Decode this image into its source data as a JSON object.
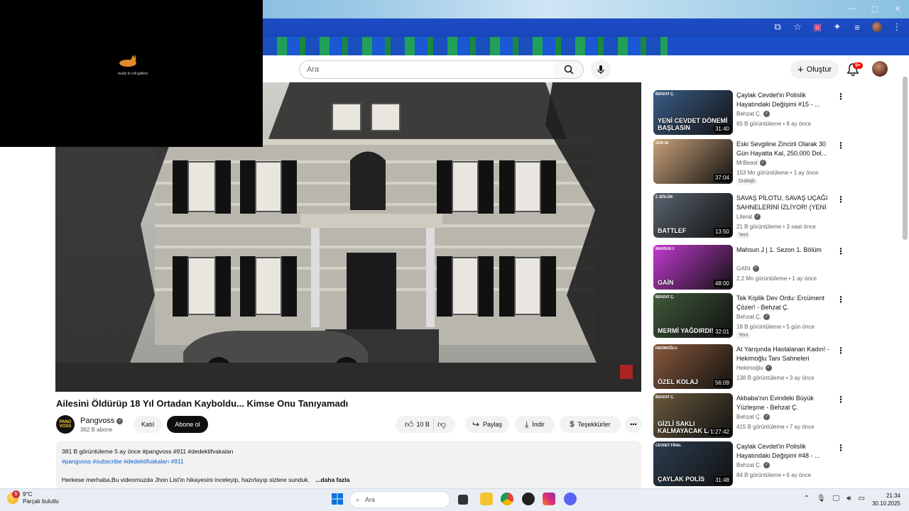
{
  "browser": {
    "window_controls": [
      "—",
      "▢",
      "✕"
    ]
  },
  "overlay": {
    "text": "ready to roll gallery"
  },
  "header": {
    "search_placeholder": "Ara",
    "create_label": "Oluştur",
    "notification_count": "9+"
  },
  "video": {
    "title": "Ailesini Öldürüp 18 Yıl Ortadan Kayboldu... Kimse Onu Tanıyamadı",
    "channel": {
      "name": "Pangvoss",
      "avatar_text": "PANG VOSS",
      "subscribers": "362 B abone"
    },
    "join_label": "Katıl",
    "subscribe_label": "Abone ol",
    "likes": "10 B",
    "share_label": "Paylaş",
    "download_label": "İndir",
    "thanks_label": "Teşekkürler",
    "more_label": "•••"
  },
  "description": {
    "stats": "381 B görüntüleme  5 ay önce  #pangvoss #911 #dedektifvakaları",
    "tags": "#pangvoss #subscribe #dedektifvakaları #911",
    "body": "Herkese merhaba.Bu videomuzda Jhon List'in hikayesini inceleyip, hazırlayıp sizlere sunduk.",
    "more": "...daha fazla"
  },
  "recommendations": [
    {
      "title": "Çaylak Cevdet'in Polislik Hayatındaki Değişimi #15 - ...",
      "channel": "Behzat Ç.",
      "meta": "65 B görüntüleme • 8 ay önce",
      "duration": "31:40",
      "thumb_text": "YENİ CEVDET DÖNEMİ BAŞLASIN",
      "thumb_tag": "BEHZAT Ç.",
      "badge": "",
      "color": "#3b5e88"
    },
    {
      "title": "Eski Sevgiline Zincirli Olarak 30 Gün Hayatta Kal, 250.000 Dol...",
      "channel": "MrBeast",
      "meta": "153 Mn görüntüleme • 1 ay önce",
      "duration": "37:04",
      "thumb_text": "",
      "thumb_tag": "GÜN 29",
      "badge": "Dublajlı",
      "color": "#c9a27a"
    },
    {
      "title": "SAVAŞ PİLOTU, SAVAŞ UÇAĞI SAHNELERİNİ İZLİYOR! (YENİ ...",
      "channel": "Literat",
      "meta": "21 B görüntüleme • 3 saat önce",
      "duration": "13:50",
      "thumb_text": "BATTLEF",
      "thumb_tag": "2. BÖLÜM",
      "badge": "Yeni",
      "color": "#5a6470"
    },
    {
      "title": "Mahsun J | 1. Sezon 1. Bölüm",
      "channel": "GAİN",
      "meta": "2,2 Mn görüntüleme • 1 ay önce",
      "duration": "48:00",
      "thumb_text": "GAİN",
      "thumb_tag": "MAHSUN J",
      "badge": "",
      "color": "#c23ad0"
    },
    {
      "title": "Tek Kişilik Dev Ordu: Ercüment Çözer! - Behzat Ç.",
      "channel": "Behzat Ç.",
      "meta": "18 B görüntüleme • 5 gün önce",
      "duration": "32:01",
      "thumb_text": "MERMİ YAĞDIRDI!",
      "thumb_tag": "BEHZAT Ç.",
      "badge": "Yeni",
      "color": "#3f5a3a"
    },
    {
      "title": "At Yarışında Hastalanan Kadın! - Hekimoğlu Tanı Sahneleri",
      "channel": "Hekimoğlu",
      "meta": "138 B görüntüleme • 3 ay önce",
      "duration": "56:09",
      "thumb_text": "ÖZEL KOLAJ",
      "thumb_tag": "HEKİMOĞLU",
      "badge": "",
      "color": "#8a5a3c"
    },
    {
      "title": "Akbaba'nın Evindeki Büyük Yüzleşme - Behzat Ç.",
      "channel": "Behzat Ç.",
      "meta": "415 B görüntüleme • 7 ay önce",
      "duration": "1:27:42",
      "thumb_text": "GİZLİ SAKLI KALMAYACAK LA!",
      "thumb_tag": "BEHZAT Ç.",
      "badge": "",
      "color": "#6b5a3e"
    },
    {
      "title": "Çaylak Cevdet'in Polislik Hayatındaki Değişimi #48 - ...",
      "channel": "Behzat Ç.",
      "meta": "84 B görüntüleme • 6 ay önce",
      "duration": "31:48",
      "thumb_text": "ÇAYLAK POLİS",
      "thumb_tag": "CEVDET FİNAL",
      "badge": "",
      "color": "#2c3e50"
    }
  ],
  "taskbar": {
    "weather_temp": "9°C",
    "weather_desc": "Parçalı bulutlu",
    "weather_badge": "5",
    "search_label": "Ara",
    "time": "21:34",
    "date": "30.10.2025"
  }
}
